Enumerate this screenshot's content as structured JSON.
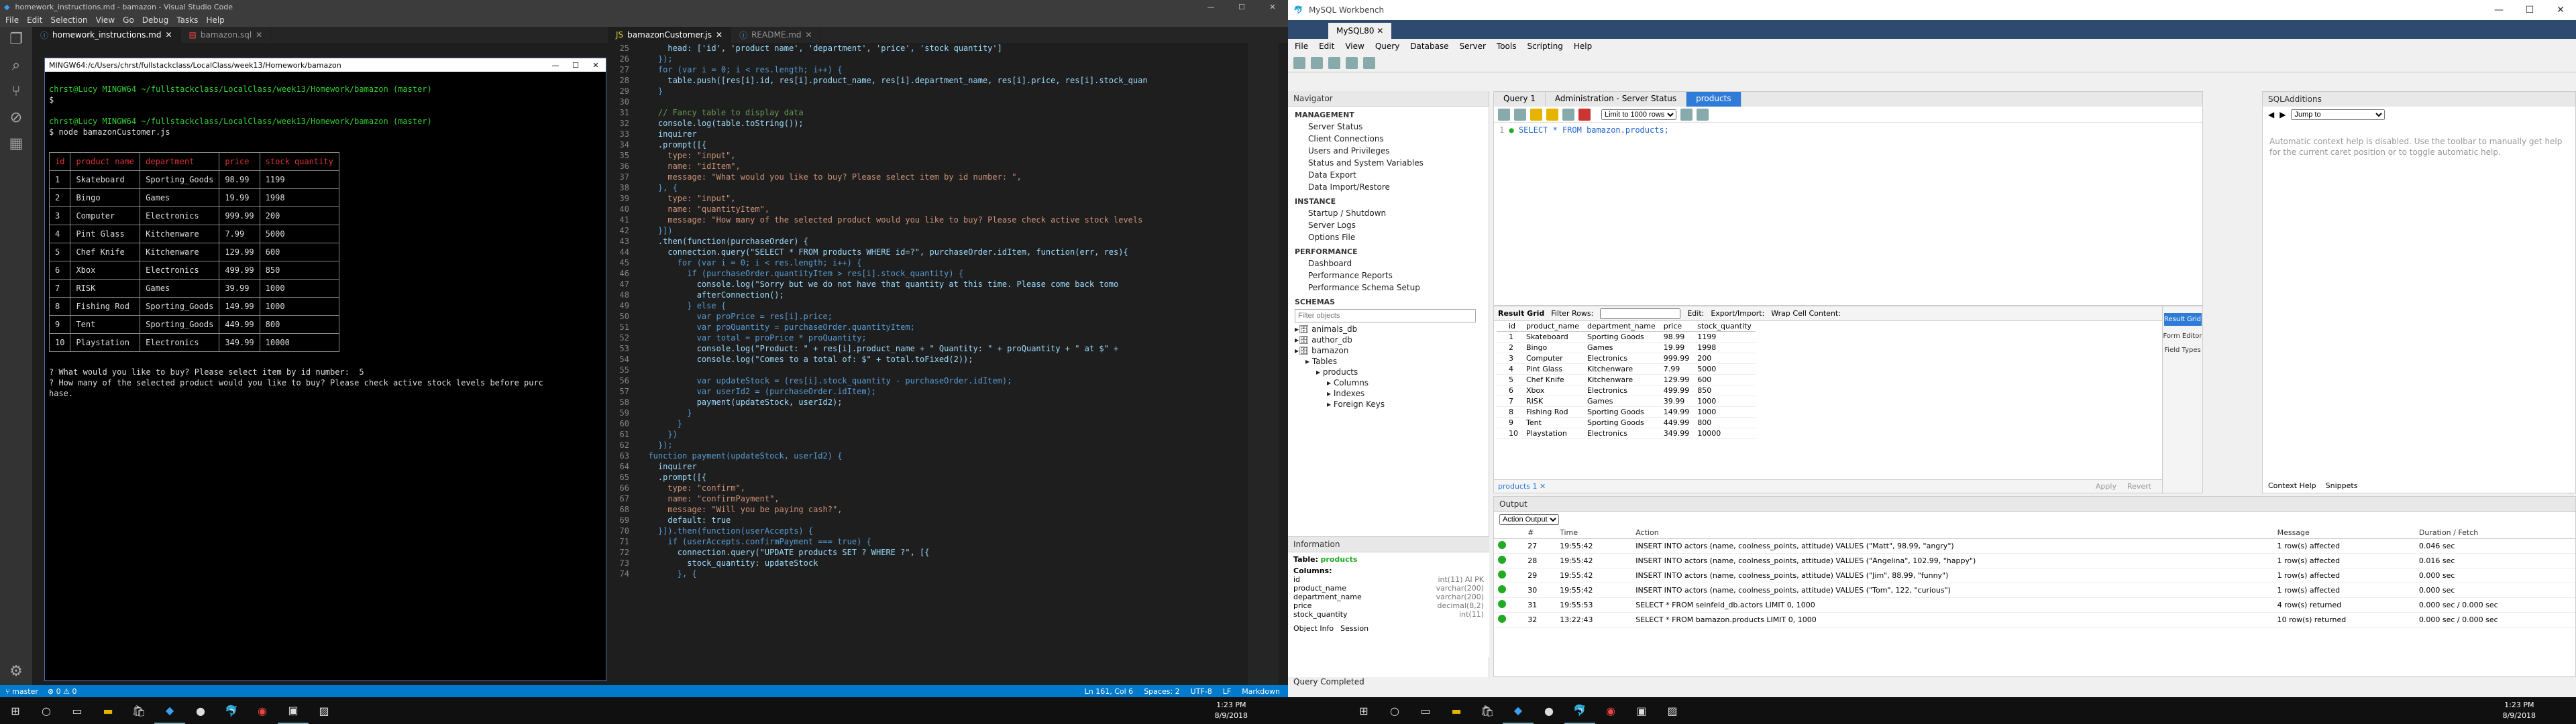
{
  "vscode": {
    "title": "homework_instructions.md - bamazon - Visual Studio Code",
    "menu": [
      "File",
      "Edit",
      "Selection",
      "View",
      "Go",
      "Debug",
      "Tasks",
      "Help"
    ],
    "tabs_left": [
      {
        "name": "homework_instructions.md",
        "type": "md"
      },
      {
        "name": "bamazon.sql",
        "type": "sql"
      }
    ],
    "tabs_right": [
      {
        "name": "bamazonCustomer.js",
        "type": "js"
      },
      {
        "name": "README.md",
        "type": "md"
      }
    ],
    "terminal": {
      "title": "MINGW64:/c/Users/chrst/fullstackclass/LocalClass/week13/Homework/bamazon",
      "prompt1": "chrst@Lucy MINGW64 ~/fullstackclass/LocalClass/week13/Homework/bamazon (master)",
      "cmd1": "$",
      "prompt2": "chrst@Lucy MINGW64 ~/fullstackclass/LocalClass/week13/Homework/bamazon (master)",
      "cmd2": "$ node bamazonCustomer.js",
      "headers": [
        "id",
        "product name",
        "department",
        "price",
        "stock quantity"
      ],
      "rows": [
        [
          "1",
          "Skateboard",
          "Sporting_Goods",
          "98.99",
          "1199"
        ],
        [
          "2",
          "Bingo",
          "Games",
          "19.99",
          "1998"
        ],
        [
          "3",
          "Computer",
          "Electronics",
          "999.99",
          "200"
        ],
        [
          "4",
          "Pint Glass",
          "Kitchenware",
          "7.99",
          "5000"
        ],
        [
          "5",
          "Chef Knife",
          "Kitchenware",
          "129.99",
          "600"
        ],
        [
          "6",
          "Xbox",
          "Electronics",
          "499.99",
          "850"
        ],
        [
          "7",
          "RISK",
          "Games",
          "39.99",
          "1000"
        ],
        [
          "8",
          "Fishing Rod",
          "Sporting_Goods",
          "149.99",
          "1000"
        ],
        [
          "9",
          "Tent",
          "Sporting_Goods",
          "449.99",
          "800"
        ],
        [
          "10",
          "Playstation",
          "Electronics",
          "349.99",
          "10000"
        ]
      ],
      "q1": "? What would you like to buy? Please select item by id number:  5",
      "q2": "? How many of the selected product would you like to buy? Please check active stock levels before purc",
      "q3": "hase."
    },
    "code_start_line": 25,
    "code": [
      "      head: ['id', 'product name', 'department', 'price', 'stock quantity']",
      "    });",
      "    for (var i = 0; i < res.length; i++) {",
      "      table.push([res[i].id, res[i].product_name, res[i].department_name, res[i].price, res[i].stock_quan",
      "    }",
      "",
      "    // Fancy table to display data",
      "    console.log(table.toString());",
      "    inquirer",
      "    .prompt([{",
      "      type: \"input\",",
      "      name: \"idItem\",",
      "      message: \"What would you like to buy? Please select item by id number: \",",
      "    }, {",
      "      type: \"input\",",
      "      name: \"quantityItem\",",
      "      message: \"How many of the selected product would you like to buy? Please check active stock levels",
      "    }])",
      "    .then(function(purchaseOrder) {",
      "      connection.query(\"SELECT * FROM products WHERE id=?\", purchaseOrder.idItem, function(err, res){",
      "        for (var i = 0; i < res.length; i++) {",
      "          if (purchaseOrder.quantityItem > res[i].stock_quantity) {",
      "            console.log(\"Sorry but we do not have that quantity at this time. Please come back tomo",
      "            afterConnection();",
      "          } else {",
      "            var proPrice = res[i].price;",
      "            var proQuantity = purchaseOrder.quantityItem;",
      "            var total = proPrice * proQuantity;",
      "            console.log(\"Product: \" + res[i].product_name + \" Quantity: \" + proQuantity + \" at $\" +",
      "            console.log(\"Comes to a total of: $\" + total.toFixed(2));",
      "",
      "            var updateStock = (res[i].stock_quantity - purchaseOrder.idItem);",
      "            var userId2 = (purchaseOrder.idItem);",
      "            payment(updateStock, userId2);",
      "          }",
      "        }",
      "      })",
      "    });",
      "  function payment(updateStock, userId2) {",
      "    inquirer",
      "    .prompt([{",
      "      type: \"confirm\",",
      "      name: \"confirmPayment\",",
      "      message: \"Will you be paying cash?\",",
      "      default: true",
      "    }]).then(function(userAccepts) {",
      "      if (userAccepts.confirmPayment === true) {",
      "        connection.query(\"UPDATE products SET ? WHERE ?\", [{",
      "          stock_quantity: updateStock",
      "        }, {"
    ],
    "status": {
      "branch": "master",
      "errors": "0",
      "warnings": "0",
      "position": "Ln 161, Col 6",
      "spaces": "Spaces: 2",
      "encoding": "UTF-8",
      "eol": "LF",
      "lang": "Markdown"
    }
  },
  "workbench": {
    "title": "MySQL Workbench",
    "conn_tab": "MySQL80",
    "menu": [
      "File",
      "Edit",
      "View",
      "Query",
      "Database",
      "Server",
      "Tools",
      "Scripting",
      "Help"
    ],
    "navigator": "Navigator",
    "management": {
      "label": "MANAGEMENT",
      "items": [
        "Server Status",
        "Client Connections",
        "Users and Privileges",
        "Status and System Variables",
        "Data Export",
        "Data Import/Restore"
      ]
    },
    "instance": {
      "label": "INSTANCE",
      "items": [
        "Startup / Shutdown",
        "Server Logs",
        "Options File"
      ]
    },
    "performance": {
      "label": "PERFORMANCE",
      "items": [
        "Dashboard",
        "Performance Reports",
        "Performance Schema Setup"
      ]
    },
    "schemas_label": "SCHEMAS",
    "filter_placeholder": "Filter objects",
    "schemas": [
      "animals_db",
      "author_db",
      "bamazon",
      "Tables",
      "products",
      "Columns",
      "Indexes",
      "Foreign Keys"
    ],
    "info": {
      "header": "Information",
      "table_label": "Table:",
      "table_name": "products",
      "columns_label": "Columns:",
      "columns": [
        [
          "id",
          "int(11) AI PK"
        ],
        [
          "product_name",
          "varchar(200)"
        ],
        [
          "department_name",
          "varchar(200)"
        ],
        [
          "price",
          "decimal(8,2)"
        ],
        [
          "stock_quantity",
          "int(11)"
        ]
      ],
      "tabs": [
        "Object Info",
        "Session"
      ]
    },
    "query_tabs": [
      "Query 1",
      "Administration - Server Status",
      "products"
    ],
    "limit": "Limit to 1000 rows",
    "query_line": "1",
    "query": "SELECT * FROM bamazon.products;",
    "result": {
      "label": "Result Grid",
      "filter": "Filter Rows:",
      "edit": "Edit:",
      "export": "Export/Import:",
      "wrap": "Wrap Cell Content:",
      "headers": [
        "id",
        "product_name",
        "department_name",
        "price",
        "stock_quantity"
      ],
      "rows": [
        [
          "1",
          "Skateboard",
          "Sporting Goods",
          "98.99",
          "1199"
        ],
        [
          "2",
          "Bingo",
          "Games",
          "19.99",
          "1998"
        ],
        [
          "3",
          "Computer",
          "Electronics",
          "999.99",
          "200"
        ],
        [
          "4",
          "Pint Glass",
          "Kitchenware",
          "7.99",
          "5000"
        ],
        [
          "5",
          "Chef Knife",
          "Kitchenware",
          "129.99",
          "600"
        ],
        [
          "6",
          "Xbox",
          "Electronics",
          "499.99",
          "850"
        ],
        [
          "7",
          "RISK",
          "Games",
          "39.99",
          "1000"
        ],
        [
          "8",
          "Fishing Rod",
          "Sporting Goods",
          "149.99",
          "1000"
        ],
        [
          "9",
          "Tent",
          "Sporting Goods",
          "449.99",
          "800"
        ],
        [
          "10",
          "Playstation",
          "Electronics",
          "349.99",
          "10000"
        ]
      ],
      "tab": "products 1",
      "side": [
        "Result Grid",
        "Form Editor",
        "Field Types"
      ],
      "apply": "Apply",
      "revert": "Revert"
    },
    "sqladd": {
      "header": "SQLAdditions",
      "jump": "Jump to",
      "msg": "Automatic context help is disabled. Use the toolbar to manually get help for the current caret position or to toggle automatic help.",
      "tabs": [
        "Context Help",
        "Snippets"
      ]
    },
    "output": {
      "header": "Output",
      "mode": "Action Output",
      "cols": [
        "",
        "#",
        "Time",
        "Action",
        "Message",
        "Duration / Fetch"
      ],
      "rows": [
        [
          "27",
          "19:55:42",
          "INSERT INTO actors (name, coolness_points, attitude) VALUES (\"Matt\", 98.99, \"angry\")",
          "1 row(s) affected",
          "0.046 sec"
        ],
        [
          "28",
          "19:55:42",
          "INSERT INTO actors (name, coolness_points, attitude) VALUES (\"Angelina\", 102.99, \"happy\")",
          "1 row(s) affected",
          "0.016 sec"
        ],
        [
          "29",
          "19:55:42",
          "INSERT INTO actors (name, coolness_points, attitude) VALUES (\"Jim\", 88.99, \"funny\")",
          "1 row(s) affected",
          "0.000 sec"
        ],
        [
          "30",
          "19:55:42",
          "INSERT INTO actors (name, coolness_points, attitude) VALUES (\"Tom\", 122, \"curious\")",
          "1 row(s) affected",
          "0.000 sec"
        ],
        [
          "31",
          "19:55:53",
          "SELECT * FROM seinfeld_db.actors LIMIT 0, 1000",
          "4 row(s) returned",
          "0.000 sec / 0.000 sec"
        ],
        [
          "32",
          "13:22:43",
          "SELECT * FROM bamazon.products LIMIT 0, 1000",
          "10 row(s) returned",
          "0.000 sec / 0.000 sec"
        ]
      ]
    },
    "status": "Query Completed"
  },
  "taskbar": {
    "left_time": "1:23 PM",
    "left_date": "8/9/2018",
    "right_time": "1:23 PM",
    "right_date": "8/9/2018"
  }
}
